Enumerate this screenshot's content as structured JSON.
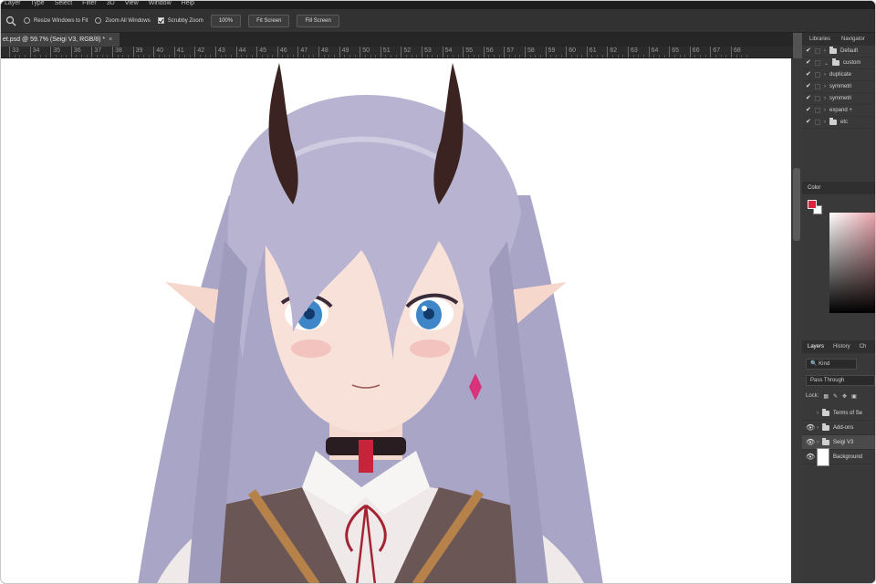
{
  "menu": [
    "Layer",
    "Type",
    "Select",
    "Filter",
    "3D",
    "View",
    "Window",
    "Help"
  ],
  "options": {
    "resize_windows": "Resize Windows to Fit",
    "zoom_all": "Zoom All Windows",
    "scrubby": "Scrubby Zoom",
    "zoom_value": "100%",
    "fit_screen": "Fit Screen",
    "fill_screen": "Fill Screen"
  },
  "doc_tab": {
    "title": "et.psd @ 59.7% (Seigi V3, RGB/8) *",
    "close": "×"
  },
  "ruler": [
    "33",
    "34",
    "35",
    "36",
    "37",
    "38",
    "39",
    "40",
    "41",
    "42",
    "43",
    "44",
    "45",
    "46",
    "47",
    "48",
    "49",
    "50",
    "51",
    "52",
    "53",
    "54",
    "55",
    "56",
    "57",
    "58",
    "59",
    "60",
    "61",
    "62",
    "63",
    "64",
    "65",
    "66",
    "67",
    "68"
  ],
  "panel_tabs": [
    "Libraries",
    "Navigator"
  ],
  "top_layers": [
    {
      "label": "Default",
      "vis": "✔",
      "chev": "›",
      "folder": true
    },
    {
      "label": "custom",
      "vis": "✔",
      "chev": "⌄",
      "folder": true
    },
    {
      "label": "duplicate",
      "vis": "✔",
      "chev": "›",
      "folder": false
    },
    {
      "label": "symmetri",
      "vis": "✔",
      "chev": "›",
      "folder": false
    },
    {
      "label": "symmetri",
      "vis": "✔",
      "chev": "›",
      "folder": false
    },
    {
      "label": "expand +",
      "vis": "✔",
      "chev": "›",
      "folder": false
    },
    {
      "label": "etc",
      "vis": "✔",
      "chev": "›",
      "folder": true
    }
  ],
  "color_panel": {
    "title": "Color",
    "fg": "#d12a3c",
    "bg": "#ffffff"
  },
  "layers_panel": {
    "tabs": [
      "Layers",
      "History",
      "Ch"
    ],
    "kind": "Kind",
    "blend": "Pass Through",
    "lock_label": "Lock:",
    "rows": [
      {
        "label": "Terms of Se",
        "eye": "",
        "folder": true
      },
      {
        "label": "Add-ons",
        "eye": "👁",
        "folder": true
      },
      {
        "label": "Seigi V3",
        "eye": "👁",
        "folder": true,
        "selected": true
      },
      {
        "label": "Background",
        "eye": "👁",
        "folder": false
      }
    ]
  },
  "colors": {
    "hair": "#b7b3d0",
    "eye": "#3f86c9",
    "horn": "#3a2320",
    "accent": "#d12a3c"
  }
}
